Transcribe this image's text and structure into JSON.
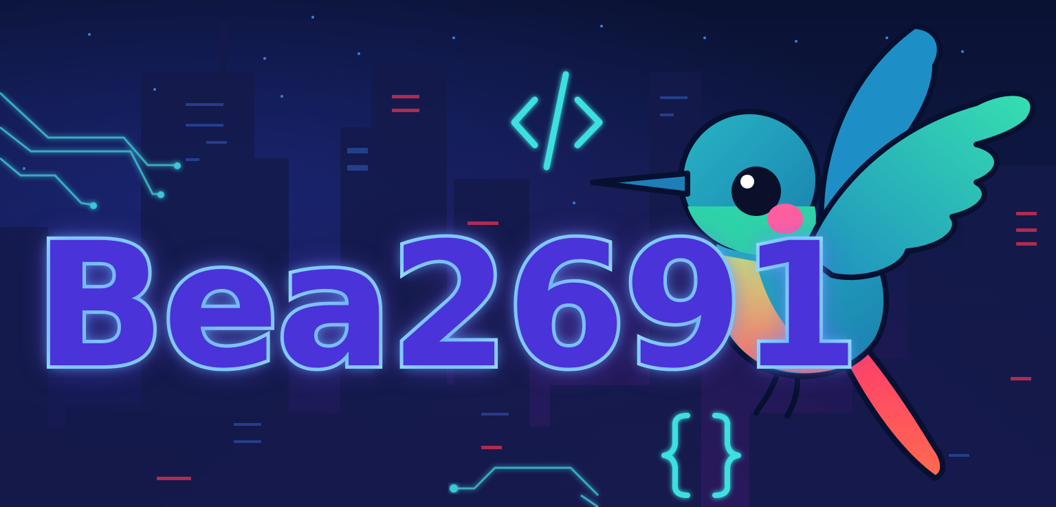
{
  "banner": {
    "username": "Bea2691",
    "code_tag_symbol": "</>",
    "braces_symbol": "{ }",
    "mascot": "hummingbird",
    "colors": {
      "background_top": "#0a1233",
      "background_bottom": "#1a1550",
      "neon_cyan": "#3de0e0",
      "text_fill": "#4a33d8",
      "text_outline": "#9fe8ff",
      "bird_body": "#1fa3b8",
      "bird_wing": "#30d6b0",
      "bird_tail": "#ff4f6b",
      "bird_cheek": "#ff5fa0"
    }
  }
}
